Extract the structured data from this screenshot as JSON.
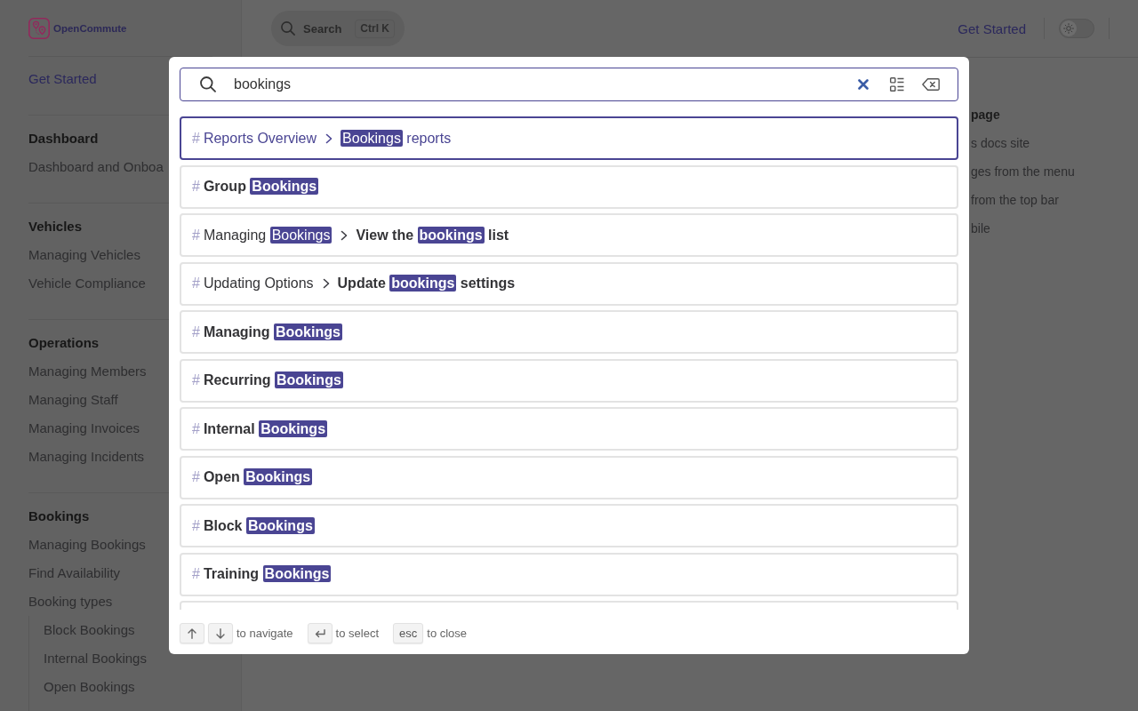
{
  "sidebar": {
    "logo": {
      "text": "OpenCommute"
    },
    "sections": [
      {
        "items": [
          {
            "label": "Get Started",
            "selected": true
          }
        ]
      },
      {
        "heading": "Dashboard",
        "items": [
          {
            "label": "Dashboard and Onboa",
            "selected": false
          }
        ]
      },
      {
        "heading": "Vehicles",
        "items": [
          {
            "label": "Managing Vehicles",
            "selected": false
          },
          {
            "label": "Vehicle Compliance",
            "selected": false
          }
        ]
      },
      {
        "heading": "Operations",
        "items": [
          {
            "label": "Managing Members",
            "selected": false
          },
          {
            "label": "Managing Staff",
            "selected": false
          },
          {
            "label": "Managing Invoices",
            "selected": false
          },
          {
            "label": "Managing Incidents",
            "selected": false
          }
        ]
      },
      {
        "heading": "Bookings",
        "items": [
          {
            "label": "Managing Bookings",
            "selected": false
          },
          {
            "label": "Find Availability",
            "selected": false
          },
          {
            "label": "Booking types",
            "selected": false,
            "children": [
              {
                "label": "Block Bookings",
                "selected": false
              },
              {
                "label": "Internal Bookings",
                "selected": false
              },
              {
                "label": "Open Bookings",
                "selected": false
              }
            ]
          }
        ]
      }
    ]
  },
  "header": {
    "search": {
      "label": "Search",
      "shortcut": "Ctrl K"
    },
    "nav": [
      {
        "label": "Get Started",
        "selected": true
      }
    ],
    "appearance_switch": {
      "checked": false
    }
  },
  "outline": {
    "title": "page",
    "items": [
      "s docs site",
      "ges from the menu",
      "from the top bar",
      "bile"
    ]
  },
  "search_dialog": {
    "query": "bookings",
    "results": [
      {
        "marker": "#",
        "selected": true,
        "parent": [
          {
            "text": "Reports Overview",
            "match": false
          }
        ],
        "title": [
          {
            "text": "Bookings",
            "match": true
          },
          {
            "text": " reports",
            "match": false
          }
        ]
      },
      {
        "marker": "#",
        "selected": false,
        "title": [
          {
            "text": "Group ",
            "match": false
          },
          {
            "text": "Bookings",
            "match": true
          }
        ]
      },
      {
        "marker": "#",
        "selected": false,
        "parent": [
          {
            "text": "Managing ",
            "match": false
          },
          {
            "text": "Bookings",
            "match": true
          }
        ],
        "title": [
          {
            "text": "View the ",
            "match": false
          },
          {
            "text": "bookings",
            "match": true
          },
          {
            "text": " list",
            "match": false
          }
        ]
      },
      {
        "marker": "#",
        "selected": false,
        "parent": [
          {
            "text": "Updating Options",
            "match": false
          }
        ],
        "title": [
          {
            "text": "Update ",
            "match": false
          },
          {
            "text": "bookings",
            "match": true
          },
          {
            "text": " settings",
            "match": false
          }
        ]
      },
      {
        "marker": "#",
        "selected": false,
        "title": [
          {
            "text": "Managing ",
            "match": false
          },
          {
            "text": "Bookings",
            "match": true
          }
        ]
      },
      {
        "marker": "#",
        "selected": false,
        "title": [
          {
            "text": "Recurring ",
            "match": false
          },
          {
            "text": "Bookings",
            "match": true
          }
        ]
      },
      {
        "marker": "#",
        "selected": false,
        "title": [
          {
            "text": "Internal ",
            "match": false
          },
          {
            "text": "Bookings",
            "match": true
          }
        ]
      },
      {
        "marker": "#",
        "selected": false,
        "title": [
          {
            "text": "Open ",
            "match": false
          },
          {
            "text": "Bookings",
            "match": true
          }
        ]
      },
      {
        "marker": "#",
        "selected": false,
        "title": [
          {
            "text": "Block ",
            "match": false
          },
          {
            "text": "Bookings",
            "match": true
          }
        ]
      },
      {
        "marker": "#",
        "selected": false,
        "title": [
          {
            "text": "Training ",
            "match": false
          },
          {
            "text": "Bookings",
            "match": true
          }
        ]
      }
    ],
    "hints": [
      {
        "keys": [
          {
            "kind": "arrow_up"
          },
          {
            "kind": "arrow_down"
          }
        ],
        "text": "to navigate"
      },
      {
        "keys": [
          {
            "kind": "enter"
          }
        ],
        "text": "to select"
      },
      {
        "keys": [
          {
            "kind": "label",
            "label": "esc"
          }
        ],
        "text": "to close"
      }
    ]
  }
}
